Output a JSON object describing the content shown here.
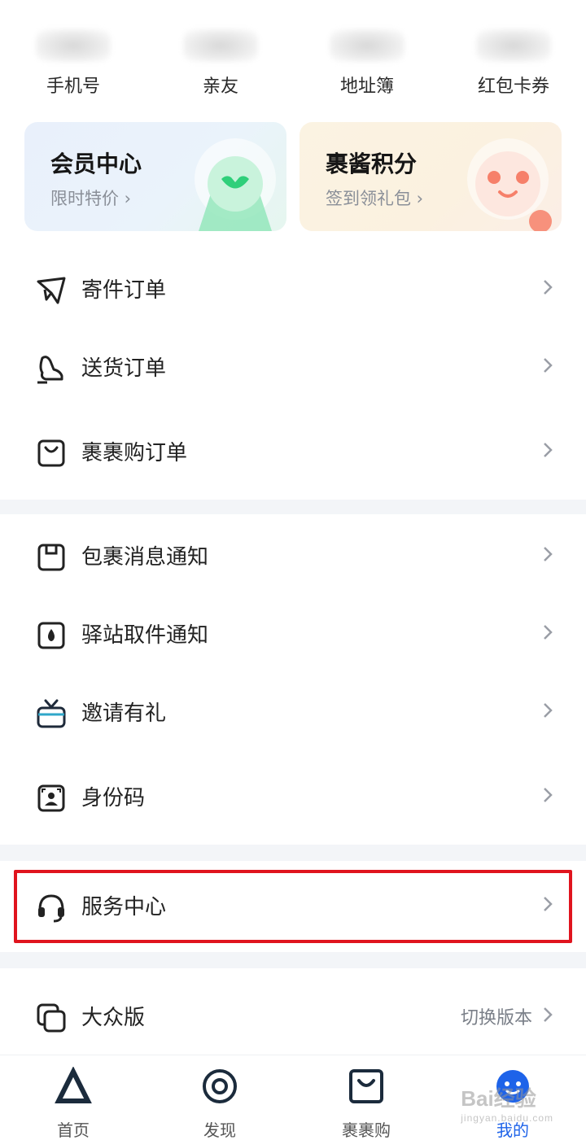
{
  "quick_links": [
    {
      "label": "手机号"
    },
    {
      "label": "亲友"
    },
    {
      "label": "地址簿"
    },
    {
      "label": "红包卡券"
    }
  ],
  "cards": {
    "member": {
      "title": "会员中心",
      "subtitle": "限时特价",
      "accent": "#3fd17d"
    },
    "points": {
      "title": "裹酱积分",
      "subtitle": "签到领礼包",
      "accent": "#f28b6f"
    }
  },
  "orders": [
    {
      "label": "寄件订单",
      "icon": "paper-plane-icon"
    },
    {
      "label": "送货订单",
      "icon": "delivery-icon"
    },
    {
      "label": "裹裹购订单",
      "icon": "shopping-bag-icon"
    }
  ],
  "notices": [
    {
      "label": "包裹消息通知",
      "icon": "package-notify-icon"
    },
    {
      "label": "驿站取件通知",
      "icon": "station-notify-icon"
    },
    {
      "label": "邀请有礼",
      "icon": "gift-tv-icon"
    },
    {
      "label": "身份码",
      "icon": "id-code-icon"
    }
  ],
  "service": {
    "label": "服务中心",
    "icon": "headset-icon"
  },
  "version": {
    "label": "大众版",
    "action": "切换版本",
    "icon": "layers-icon"
  },
  "tabbar": [
    {
      "label": "首页",
      "icon": "home-logo-icon"
    },
    {
      "label": "发现",
      "icon": "discover-icon"
    },
    {
      "label": "裹裹购",
      "icon": "shop-icon"
    },
    {
      "label": "我的",
      "icon": "profile-icon",
      "active": true
    }
  ],
  "watermark": {
    "brand": "Bai",
    "suffix": "经验",
    "url": "jingyan.baidu.com"
  },
  "colors": {
    "active": "#1e63e9",
    "highlight": "#e0141e"
  }
}
